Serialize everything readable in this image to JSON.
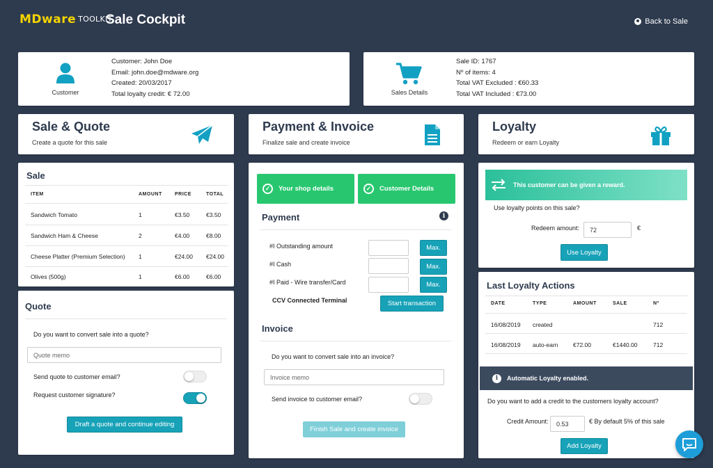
{
  "header": {
    "logo_brand": "MDware",
    "logo_suffix": "TOOLKIT",
    "title": "Sale Cockpit",
    "back_label": "Back to Sale"
  },
  "customer": {
    "caption": "Customer",
    "lines": [
      "Customer: John Doe",
      "Email: john.doe@mdware.org",
      "Created: 20/03/2017",
      "Total loyalty credit: € 72.00"
    ]
  },
  "sales_details": {
    "caption": "Sales Details",
    "lines": [
      "Sale ID: 1767",
      "Nº of items: 4",
      "Total VAT Excluded : €60.33",
      "Total VAT Included : €73.00"
    ]
  },
  "sections": {
    "sale_quote": {
      "title": "Sale & Quote",
      "subtitle": "Create a quote for this sale"
    },
    "payment_invoice": {
      "title": "Payment & Invoice",
      "subtitle": "Finalize sale and create invoice"
    },
    "loyalty": {
      "title": "Loyalty",
      "subtitle": "Redeem or earn Loyalty"
    }
  },
  "sale": {
    "title": "Sale",
    "columns": [
      "ITEM",
      "AMOUNT",
      "PRICE",
      "TOTAL"
    ],
    "rows": [
      [
        "Sandwich Tomato",
        "1",
        "€3.50",
        "€3.50"
      ],
      [
        "Sandwich Ham & Cheese",
        "2",
        "€4.00",
        "€8.00"
      ],
      [
        "Cheese Platter (Premium Selection)",
        "1",
        "€24.00",
        "€24.00"
      ],
      [
        "Olives (500g)",
        "1",
        "€6.00",
        "€6.00"
      ]
    ]
  },
  "quote": {
    "title": "Quote",
    "question": "Do you want to convert sale into a quote?",
    "memo_placeholder": "Quote memo",
    "send_email_label": "Send quote to customer email?",
    "signature_label": "Request customer signature?",
    "send_email_on": false,
    "signature_on": true,
    "draft_button": "Draft a quote and continue editing"
  },
  "payment": {
    "shop_details": "Your shop details",
    "customer_details": "Customer Details",
    "title": "Payment",
    "rows": [
      "#I Outstanding amount",
      "#I Cash",
      "#I Paid - Wire transfer/Card"
    ],
    "max_label": "Max.",
    "terminal_label": "CCV Connected Terminal",
    "start_button": "Start transaction"
  },
  "invoice": {
    "title": "Invoice",
    "question": "Do you want to convert sale into an invoice?",
    "memo_placeholder": "Invoice memo",
    "send_email_label": "Send invoice to customer email?",
    "finish_button": "Finish Sale and create invoice"
  },
  "redeem": {
    "reward_text": "This customer can be given a reward.",
    "question": "Use loyalty points on this sale?",
    "amount_label": "Redeem amount:",
    "amount_value": "72",
    "currency": "€",
    "use_button": "Use Loyalty"
  },
  "loyalty_actions": {
    "title": "Last Loyalty Actions",
    "columns": [
      "DATE",
      "TYPE",
      "AMOUNT",
      "SALE",
      "Nº"
    ],
    "rows": [
      [
        "16/08/2019",
        "created",
        "",
        "",
        "712"
      ],
      [
        "16/08/2019",
        "auto-earn",
        "€72.00",
        "€1440.00",
        "712"
      ]
    ],
    "auto_text": "Automatic Loyalty enabled.",
    "credit_question": "Do you want to add a credit to the customers loyalty account?",
    "credit_label": "Credit Amount:",
    "credit_value": "0.53",
    "credit_note": "€ By default 5% of this sale",
    "add_button": "Add Loyalty"
  }
}
